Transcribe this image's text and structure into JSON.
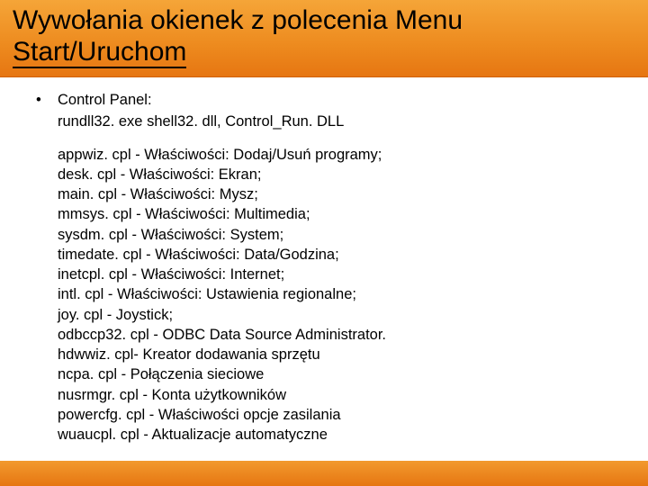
{
  "title_line1": "Wywołania okienek z polecenia Menu",
  "title_line2": "Start/Uruchom",
  "intro": {
    "line1": "Control Panel:",
    "line2": "rundll32. exe shell32. dll, Control_Run. DLL"
  },
  "items": [
    "appwiz. cpl - Właściwości: Dodaj/Usuń programy;",
    "desk. cpl - Właściwości: Ekran;",
    "main. cpl - Właściwości: Mysz;",
    "mmsys. cpl - Właściwości: Multimedia;",
    "sysdm. cpl - Właściwości: System;",
    "timedate. cpl - Właściwości: Data/Godzina;",
    "inetcpl. cpl - Właściwości: Internet;",
    "intl. cpl - Właściwości: Ustawienia regionalne;",
    "joy. cpl - Joystick;",
    "odbccp32. cpl - ODBC Data Source Administrator.",
    "hdwwiz. cpl- Kreator dodawania sprzętu",
    "ncpa. cpl - Połączenia sieciowe",
    "nusrmgr. cpl - Konta użytkowników",
    "powercfg. cpl - Właściwości opcje zasilania",
    "wuaucpl. cpl - Aktualizacje automatyczne"
  ]
}
